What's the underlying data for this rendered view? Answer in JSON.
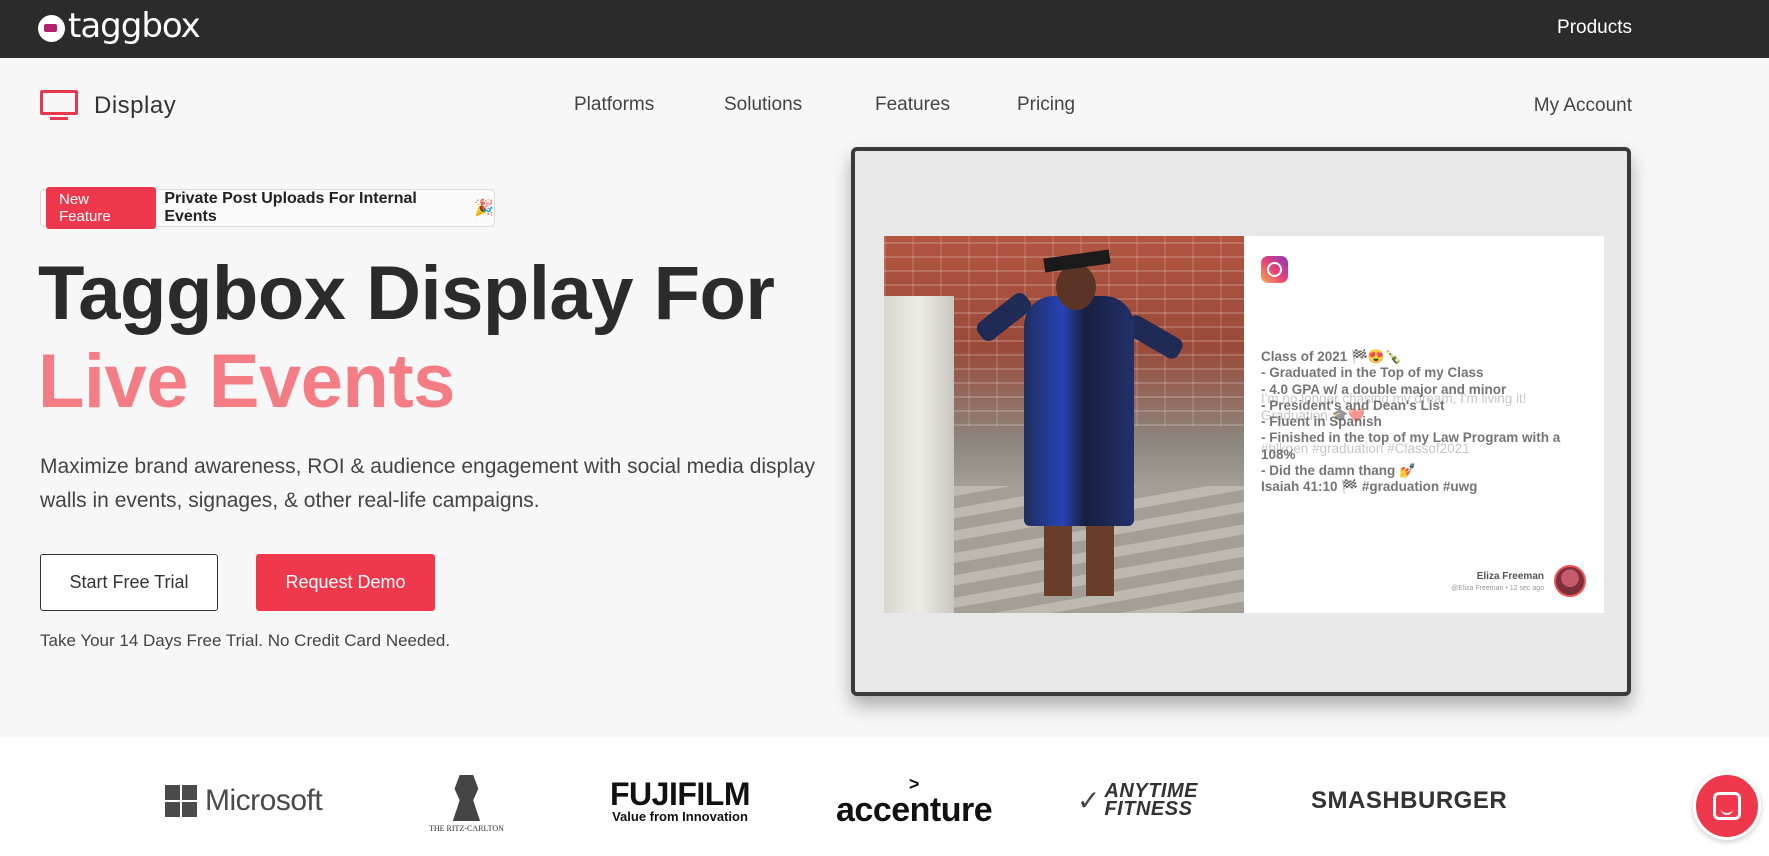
{
  "topbar": {
    "logo_text": "taggbox",
    "products_label": "Products"
  },
  "nav": {
    "brand_label": "Display",
    "items": [
      "Platforms",
      "Solutions",
      "Features",
      "Pricing"
    ],
    "account_label": "My Account"
  },
  "hero": {
    "badge_label": "New Feature",
    "badge_text": "Private Post Uploads For Internal Events",
    "badge_icon": "🎉",
    "title_line1": "Taggbox Display For",
    "title_line2": "Live Events",
    "description": "Maximize brand awareness, ROI & audience engagement with social media display walls in events, signages, & other real-life campaigns.",
    "trial_button": "Start Free Trial",
    "demo_button": "Request Demo",
    "trial_note": "Take Your 14 Days Free Trial. No Credit Card Needed."
  },
  "post": {
    "caption": "Class of 2021 🏁😍🍾\n- Graduated in the Top of my Class\n- 4.0 GPA w/ a double major and minor\n- President's and Dean's List\n- Fluent in Spanish\n- Finished in the top of my Law Program with a 108%\n- Did the damn thang 💅\nIsaiah 41:10 🏁 #graduation #uwg",
    "caption_ghost": "I'm no longer chasing my dream, I'm living it!\nGraduation 🎓❤️\n\n#blkgen #graduation #Classof2021",
    "author": "Eliza Freeman",
    "author_sub": "@Eliza Freeman • 12 sec ago"
  },
  "logos": {
    "microsoft": "Microsoft",
    "ritz": "THE RITZ-CARLTON",
    "fuji": "FUJIFILM",
    "fuji_sub": "Value from Innovation",
    "accenture": "accenture",
    "accenture_mark": ">",
    "anytime_1": "ANYTIME",
    "anytime_2": "FITNESS",
    "smashburger": "SMASHBURGER"
  },
  "colors": {
    "accent": "#f0384c",
    "title_accent": "#f47c84",
    "topbar": "#2b2b2b"
  }
}
